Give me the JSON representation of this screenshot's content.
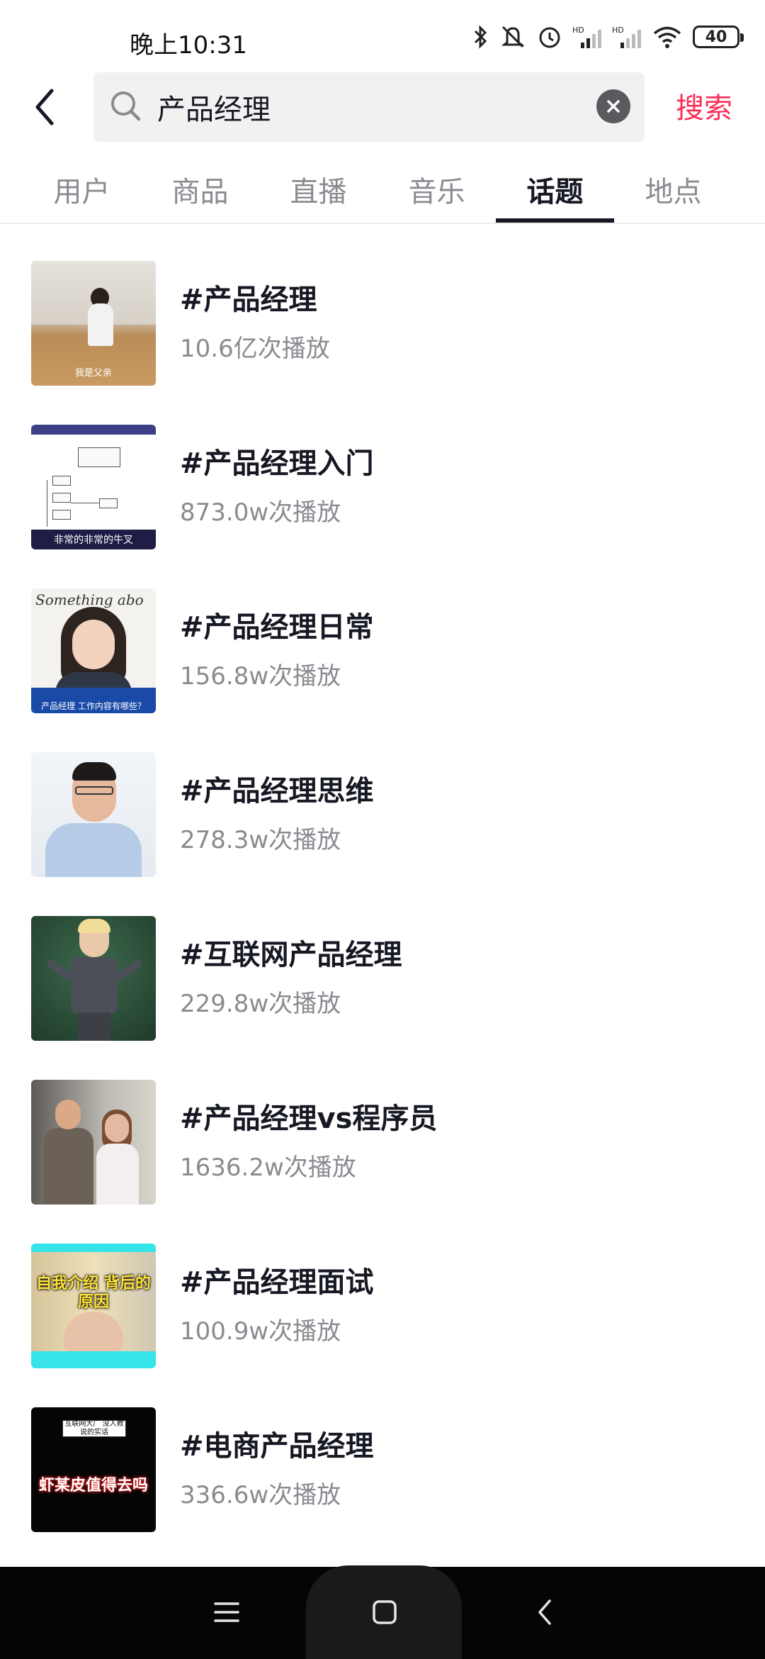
{
  "status_bar": {
    "time": "晚上10:31",
    "battery": "40",
    "icons": [
      "bluetooth-icon",
      "mute-icon",
      "alarm-icon",
      "hd-signal-icon",
      "hd-signal-icon",
      "wifi-icon",
      "battery-icon"
    ]
  },
  "search": {
    "query": "产品经理",
    "search_button": "搜索"
  },
  "tabs": [
    "用户",
    "商品",
    "直播",
    "音乐",
    "话题",
    "地点"
  ],
  "active_tab": "话题",
  "topics": [
    {
      "title": "#产品经理",
      "plays": "10.6亿次播放",
      "thumb_caption": "我是父亲"
    },
    {
      "title": "#产品经理入门",
      "plays": "873.0w次播放",
      "thumb_caption": "非常的非常的牛叉"
    },
    {
      "title": "#产品经理日常",
      "plays": "156.8w次播放",
      "thumb_caption": "产品经理 工作内容有哪些？",
      "thumb_script": "Something abo"
    },
    {
      "title": "#产品经理思维",
      "plays": "278.3w次播放"
    },
    {
      "title": "#互联网产品经理",
      "plays": "229.8w次播放"
    },
    {
      "title": "#产品经理vs程序员",
      "plays": "1636.2w次播放"
    },
    {
      "title": "#产品经理面试",
      "plays": "100.9w次播放",
      "thumb_caption": "自我介绍 背后的原因"
    },
    {
      "title": "#电商产品经理",
      "plays": "336.6w次播放",
      "thumb_caption": "虾某皮值得去吗",
      "thumb_card": "互联网大厂 没人教说的实话"
    }
  ],
  "colors": {
    "accent": "#fe2c55",
    "text_primary": "#161823",
    "text_secondary": "#8a8b91",
    "nav_bar": "#050505"
  }
}
